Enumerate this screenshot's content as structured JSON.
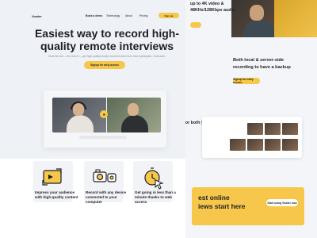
{
  "nav": {
    "logo": "Vowler",
    "items": [
      "Book a demo",
      "Technology",
      "About",
      "Pricing",
      "Sign up"
    ],
    "cta": "Sign up"
  },
  "hero": {
    "title": "Easiest way to record high-quality remote interviews",
    "subtitle": "Start the call — the rest of — get high-quality locally recorded video from each participant, in browser.",
    "cta": "Signup for early access"
  },
  "features": [
    {
      "text": "Impress your audience with high-quality content",
      "icon": "camera-frame-icon"
    },
    {
      "text": "Record with any device connected to your computer",
      "icon": "camera-device-icon"
    },
    {
      "text": "Get going in less than a minute thanks to web access",
      "icon": "clock-cursor-icon"
    }
  ],
  "back": {
    "spec_line1": "up to 4K video &",
    "spec_line2": "48KHz/128Kbps audio",
    "backup_line1": "Both local & server-side",
    "backup_line2": "recording to have a backup",
    "backup_cta": "Signup for early access",
    "team_text": "for both you &",
    "cta_line1": "est online",
    "cta_line2": "iews start here",
    "cta_button": "Start using Vowler now"
  },
  "colors": {
    "accent": "#f6c74a",
    "text": "#1e1f24",
    "muted": "#8a8e96",
    "canvas": "#eef1f5"
  }
}
